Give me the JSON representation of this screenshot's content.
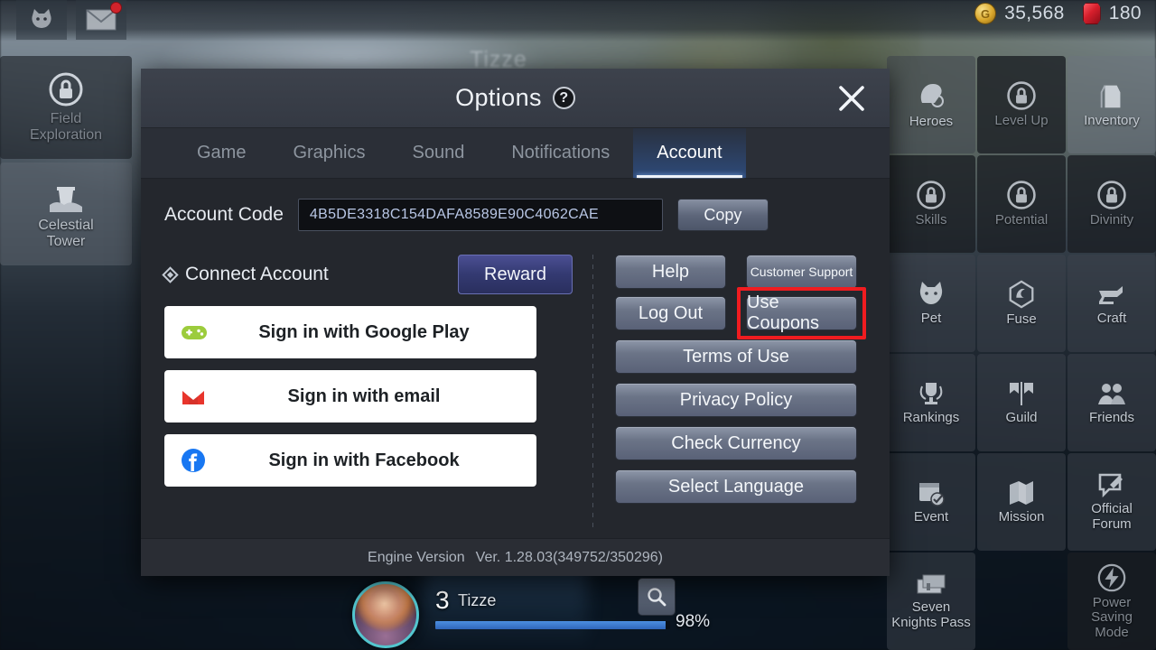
{
  "topbar": {
    "icons": [
      {
        "name": "pet-cat-icon",
        "label": "Pet"
      },
      {
        "name": "mail-icon",
        "label": "Mail",
        "badge": true
      }
    ],
    "currencies": [
      {
        "icon": "gold-coin-icon",
        "glyph": "G",
        "value": "35,568"
      },
      {
        "icon": "ruby-gem-icon",
        "value": "180"
      }
    ]
  },
  "left_rail": [
    {
      "label": "Field\nExploration",
      "locked": true,
      "icon": "lock-icon"
    },
    {
      "label": "Celestial\nTower",
      "locked": false,
      "icon": "tower-icon"
    }
  ],
  "right_rail": [
    {
      "label": "Heroes",
      "icon": "helmet-icon",
      "locked": false
    },
    {
      "label": "Level Up",
      "icon": "lock-icon",
      "locked": true
    },
    {
      "label": "Inventory",
      "icon": "backpack-icon",
      "locked": false
    },
    {
      "label": "Skills",
      "icon": "lock-icon",
      "locked": true
    },
    {
      "label": "Potential",
      "icon": "lock-icon",
      "locked": true
    },
    {
      "label": "Divinity",
      "icon": "lock-icon",
      "locked": true
    },
    {
      "label": "Pet",
      "icon": "cat-icon",
      "locked": false
    },
    {
      "label": "Fuse",
      "icon": "gem-fuse-icon",
      "locked": false
    },
    {
      "label": "Craft",
      "icon": "anvil-icon",
      "locked": false
    },
    {
      "label": "Rankings",
      "icon": "trophy-icon",
      "locked": false
    },
    {
      "label": "Guild",
      "icon": "banner-icon",
      "locked": false
    },
    {
      "label": "Friends",
      "icon": "people-icon",
      "locked": false
    },
    {
      "label": "Event",
      "icon": "calendar-icon",
      "locked": false
    },
    {
      "label": "Mission",
      "icon": "map-icon",
      "locked": false
    },
    {
      "label": "Official\nForum",
      "icon": "forum-pencil-icon",
      "locked": false
    },
    {
      "label": "Seven\nKnights Pass",
      "icon": "ticket-icon",
      "locked": false
    },
    {
      "label": "",
      "icon": "",
      "empty": true
    },
    {
      "label": "Power\nSaving\nMode",
      "icon": "power-bolt-icon",
      "locked": true
    }
  ],
  "character": {
    "level": "3",
    "name": "Tizze",
    "progress_label": "98%",
    "progress_value": 98,
    "search_icon": "search-icon",
    "world_name": "Tizze"
  },
  "dialog": {
    "title": "Options",
    "help_glyph": "?",
    "close_label": "×",
    "tabs": [
      {
        "label": "Game",
        "active": false
      },
      {
        "label": "Graphics",
        "active": false
      },
      {
        "label": "Sound",
        "active": false
      },
      {
        "label": "Notifications",
        "active": false
      },
      {
        "label": "Account",
        "active": true
      }
    ],
    "account_code": {
      "label": "Account Code",
      "value": "4B5DE3318C154DAFA8589E90C4062CAE",
      "copy_label": "Copy"
    },
    "connect": {
      "heading": "Connect Account",
      "reward_label": "Reward",
      "providers": [
        {
          "label": "Sign in with Google Play",
          "icon": "google-play-games-icon"
        },
        {
          "label": "Sign in with email",
          "icon": "gmail-icon"
        },
        {
          "label": "Sign in with Facebook",
          "icon": "facebook-icon"
        }
      ]
    },
    "actions": {
      "row1": [
        {
          "label": "Help",
          "small": false,
          "highlighted": false
        },
        {
          "label": "Customer Support",
          "small": true,
          "highlighted": false
        }
      ],
      "row2": [
        {
          "label": "Log Out",
          "small": false,
          "highlighted": false
        },
        {
          "label": "Use Coupons",
          "small": false,
          "highlighted": true
        }
      ],
      "full": [
        {
          "label": "Terms of Use"
        },
        {
          "label": "Privacy Policy"
        },
        {
          "label": "Check Currency"
        },
        {
          "label": "Select Language"
        }
      ]
    },
    "footer": {
      "label": "Engine Version",
      "version": "Ver. 1.28.03(349752/350296)"
    }
  },
  "colors": {
    "highlight": "#f01c20",
    "accent_tab": "#3060af",
    "reward": "#343a72",
    "button": "#6b7487",
    "dialog_bg": "#24272d"
  }
}
